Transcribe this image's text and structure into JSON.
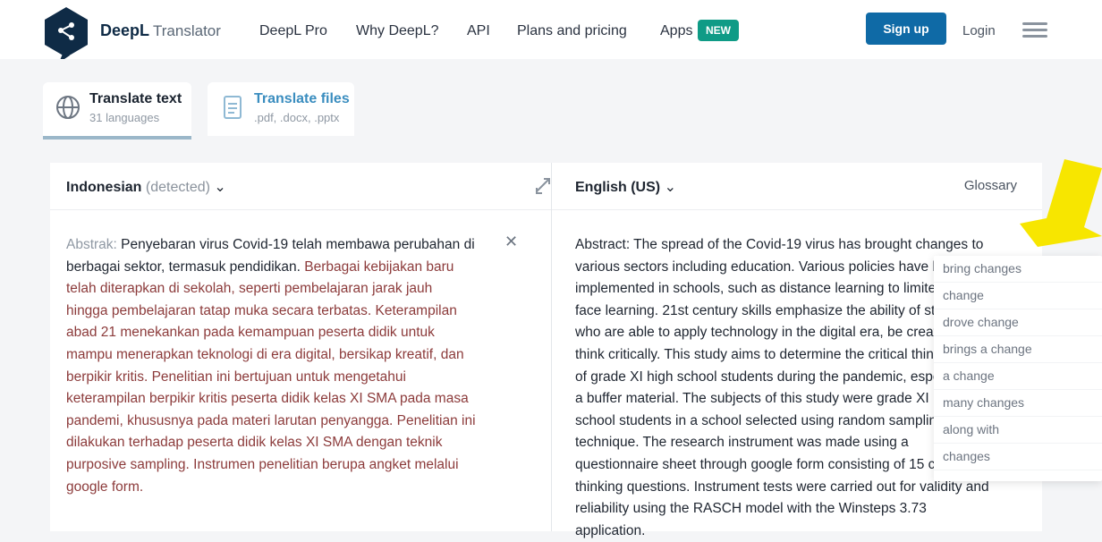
{
  "header": {
    "brand": "DeepL",
    "brand_sub": "Translator",
    "nav": [
      "DeepL Pro",
      "Why DeepL?",
      "API",
      "Plans and pricing",
      "Apps"
    ],
    "new_badge": "NEW",
    "signup_label": "Sign up",
    "login_label": "Login"
  },
  "modes": [
    {
      "title": "Translate text",
      "subtitle": "31 languages"
    },
    {
      "title": "Translate files",
      "subtitle": ".pdf, .docx, .pptx"
    }
  ],
  "source": {
    "language_label": "Indonesian",
    "language_detected": "(detected)",
    "text_label": "Abstrak:",
    "text_plain": "Penyebaran virus Covid-19 telah membawa perubahan di berbagai sektor, termasuk pendidikan.",
    "text_highlighted": "Berbagai kebijakan baru telah diterapkan di sekolah, seperti pembelajaran jarak jauh hingga pembelajaran tatap muka secara terbatas. Keterampilan abad 21 menekankan pada kemampuan peserta didik untuk mampu menerapkan teknologi di era digital, bersikap kreatif, dan berpikir kritis. Penelitian ini bertujuan untuk mengetahui keterampilan berpikir kritis peserta didik kelas XI SMA pada masa pandemi, khususnya pada materi larutan penyangga. Penelitian ini dilakukan terhadap peserta didik kelas XI SMA dengan teknik purposive sampling. Instrumen penelitian berupa angket melalui google form."
  },
  "target": {
    "language_label": "English (US)",
    "glossary_label": "Glossary",
    "text": "Abstract: The spread of the Covid-19 virus has brought changes to various sectors including education. Various policies have been implemented in schools, such as distance learning to limited face-to-face learning. 21st century skills emphasize the ability of students who are able to apply technology in the digital era, be creative and think critically. This study aims to determine the critical thinking skills of grade XI high school students during the pandemic, especially on a buffer material. The subjects of this study were grade XI high school students in a school selected using random sampling technique. The research instrument was made using a questionnaire sheet through google form consisting of 15 critical thinking questions. Instrument tests were carried out for validity and reliability using the RASCH model with the Winsteps 3.73 application."
  },
  "alternatives": [
    "bring changes",
    "change",
    "drove change",
    "brings a change",
    "a change",
    "many changes",
    "along with",
    "changes"
  ],
  "colors": {
    "brand": "#0f2b46",
    "accent": "#0f6aa6",
    "badge": "#0f9b86",
    "highlight": "#8c3b3b"
  }
}
